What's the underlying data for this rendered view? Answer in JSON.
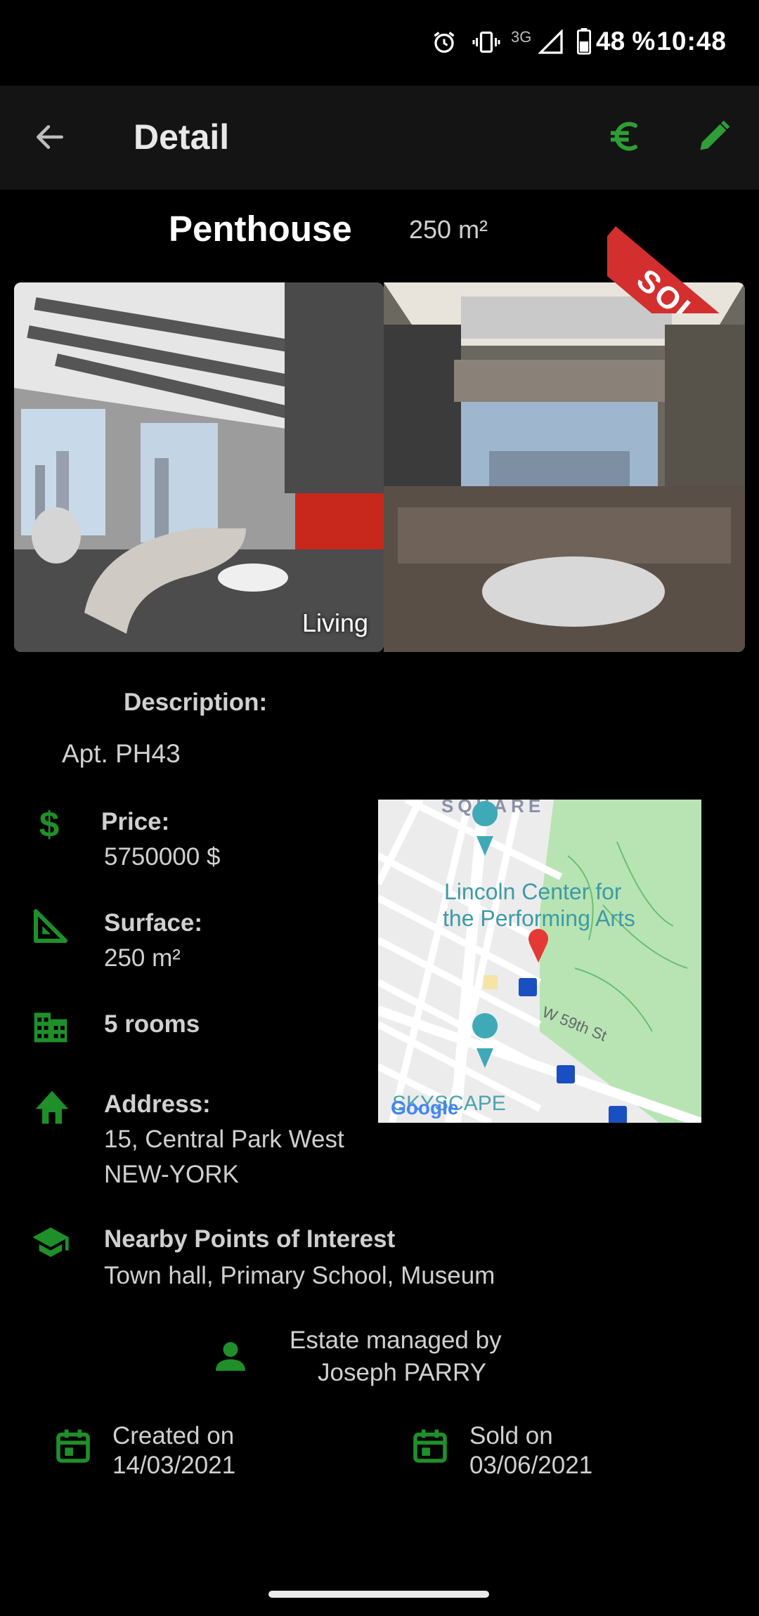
{
  "status_bar": {
    "network": "3G",
    "battery": "48 %",
    "time": "10:48",
    "icons": [
      "alarm-icon",
      "vibrate-icon",
      "signal-icon",
      "battery-icon"
    ]
  },
  "app_bar": {
    "back_icon": "arrow-back-icon",
    "title": "Detail",
    "currency_icon": "euro-icon",
    "edit_icon": "edit-pencil-icon"
  },
  "property": {
    "type": "Penthouse",
    "surface_header": "250 m²",
    "sold_badge": "SOLD",
    "photos": [
      {
        "caption": "Living"
      },
      {
        "caption": ""
      }
    ],
    "description_label": "Description:",
    "description": "Apt. PH43",
    "price_label": "Price:",
    "price": "5750000 $",
    "surface_label": "Surface:",
    "surface": "250 m²",
    "rooms": "5 rooms",
    "address_label": "Address:",
    "address_line1": "15, Central Park West",
    "address_line2": "NEW-YORK",
    "poi_label": "Nearby Points of Interest",
    "poi": "Town hall, Primary School, Museum",
    "agent_line1": "Estate managed by",
    "agent_line2": "Joseph PARRY",
    "created_label": "Created on",
    "created_date": "14/03/2021",
    "sold_label": "Sold on",
    "sold_date": "03/06/2021"
  },
  "map": {
    "labels": {
      "square": "SQUARE",
      "lincoln_center": "Lincoln Center for the Performing Arts",
      "street": "W 59th St",
      "skyscape": "SKYSCAPE",
      "google": "Google"
    }
  },
  "colors": {
    "accent_green": "#2e9e36",
    "icon_green": "#1f8f2a",
    "sold_red": "#d32f2f",
    "app_bar": "#141414",
    "background": "#000000"
  }
}
